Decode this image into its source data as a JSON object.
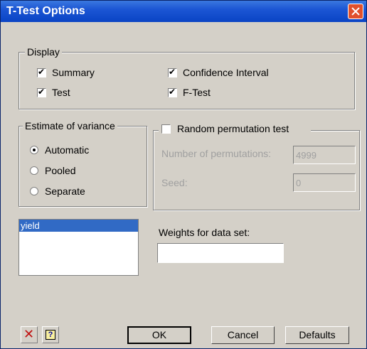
{
  "window": {
    "title": "T-Test Options"
  },
  "display": {
    "legend": "Display",
    "summary": "Summary",
    "test": "Test",
    "confidence_interval": "Confidence Interval",
    "f_test": "F-Test"
  },
  "variance": {
    "legend": "Estimate of variance",
    "options": [
      "Automatic",
      "Pooled",
      "Separate"
    ],
    "selected": "Automatic"
  },
  "permutation": {
    "label": "Random permutation test",
    "num_label": "Number of permutations:",
    "num_value": "4999",
    "seed_label": "Seed:",
    "seed_value": "0"
  },
  "datasets": {
    "items": [
      "yield"
    ]
  },
  "weights": {
    "label": "Weights for data set:",
    "value": ""
  },
  "buttons": {
    "ok": "OK",
    "cancel": "Cancel",
    "defaults": "Defaults",
    "help": "?"
  },
  "icons": {
    "close": "close-icon",
    "clear": "clear-x-icon",
    "help": "help-icon"
  }
}
